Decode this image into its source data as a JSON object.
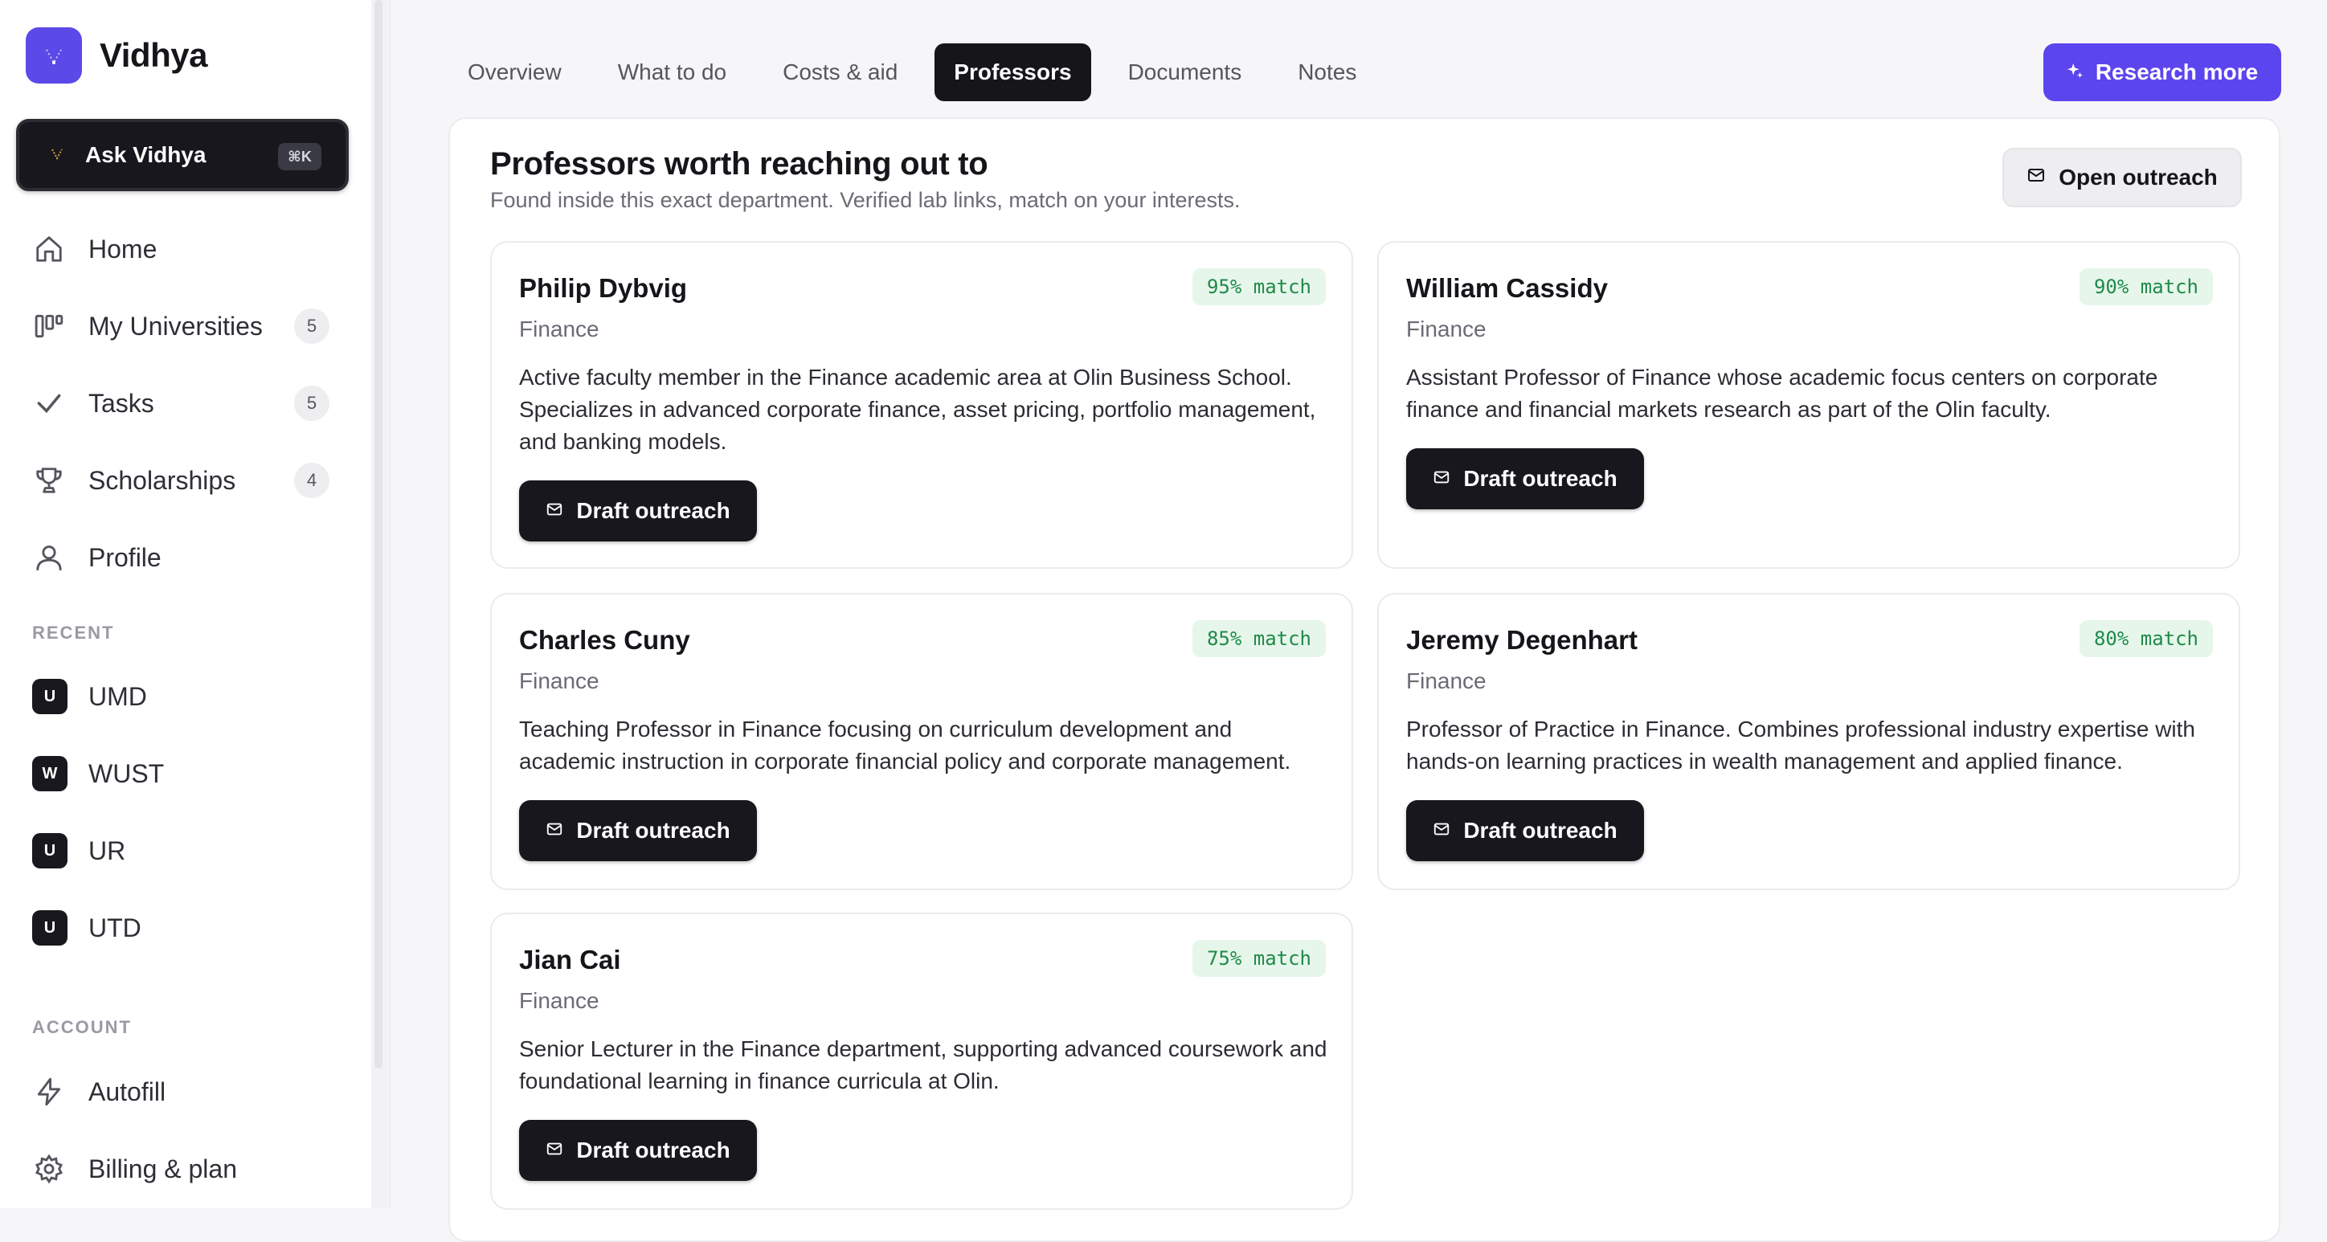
{
  "brand": {
    "name": "Vidhya",
    "accent": "#5b49e8"
  },
  "ask": {
    "label": "Ask Vidhya",
    "shortcut": "⌘K"
  },
  "nav": [
    {
      "label": "Home",
      "icon": "home-icon",
      "count": ""
    },
    {
      "label": "My Universities",
      "icon": "columns-icon",
      "count": "5"
    },
    {
      "label": "Tasks",
      "icon": "check-icon",
      "count": "5"
    },
    {
      "label": "Scholarships",
      "icon": "trophy-icon",
      "count": "4"
    },
    {
      "label": "Profile",
      "icon": "user-icon",
      "count": ""
    }
  ],
  "recent": {
    "heading": "RECENT",
    "items": [
      {
        "badge": "U",
        "label": "UMD"
      },
      {
        "badge": "W",
        "label": "WUST"
      },
      {
        "badge": "U",
        "label": "UR"
      },
      {
        "badge": "U",
        "label": "UTD"
      }
    ]
  },
  "account": {
    "heading": "ACCOUNT",
    "items": [
      {
        "label": "Autofill",
        "icon": "lightning-icon"
      },
      {
        "label": "Billing & plan",
        "icon": "gear-icon"
      }
    ]
  },
  "tabs": [
    {
      "label": "Overview",
      "active": false
    },
    {
      "label": "What to do",
      "active": false
    },
    {
      "label": "Costs & aid",
      "active": false
    },
    {
      "label": "Professors",
      "active": true
    },
    {
      "label": "Documents",
      "active": false
    },
    {
      "label": "Notes",
      "active": false
    }
  ],
  "research_button": {
    "label": "Research more",
    "color": "#5b45ee"
  },
  "panel": {
    "title": "Professors worth reaching out to",
    "subtitle": "Found inside this exact department. Verified lab links, match on your interests.",
    "open_outreach_label": "Open outreach"
  },
  "professors": [
    {
      "name": "Philip Dybvig",
      "dept": "Finance",
      "match": "95% match",
      "desc": "Active faculty member in the Finance academic area at Olin Business School. Specializes in advanced corporate finance, asset pricing, portfolio management, and banking models.",
      "button": "Draft outreach"
    },
    {
      "name": "William Cassidy",
      "dept": "Finance",
      "match": "90% match",
      "desc": "Assistant Professor of Finance whose academic focus centers on corporate finance and financial markets research as part of the Olin faculty.",
      "button": "Draft outreach"
    },
    {
      "name": "Charles Cuny",
      "dept": "Finance",
      "match": "85% match",
      "desc": "Teaching Professor in Finance focusing on curriculum development and academic instruction in corporate financial policy and corporate management.",
      "button": "Draft outreach"
    },
    {
      "name": "Jeremy Degenhart",
      "dept": "Finance",
      "match": "80% match",
      "desc": "Professor of Practice in Finance. Combines professional industry expertise with hands-on learning practices in wealth management and applied finance.",
      "button": "Draft outreach"
    },
    {
      "name": "Jian Cai",
      "dept": "Finance",
      "match": "75% match",
      "desc": "Senior Lecturer in the Finance department, supporting advanced coursework and foundational learning in finance curricula at Olin.",
      "button": "Draft outreach"
    }
  ]
}
